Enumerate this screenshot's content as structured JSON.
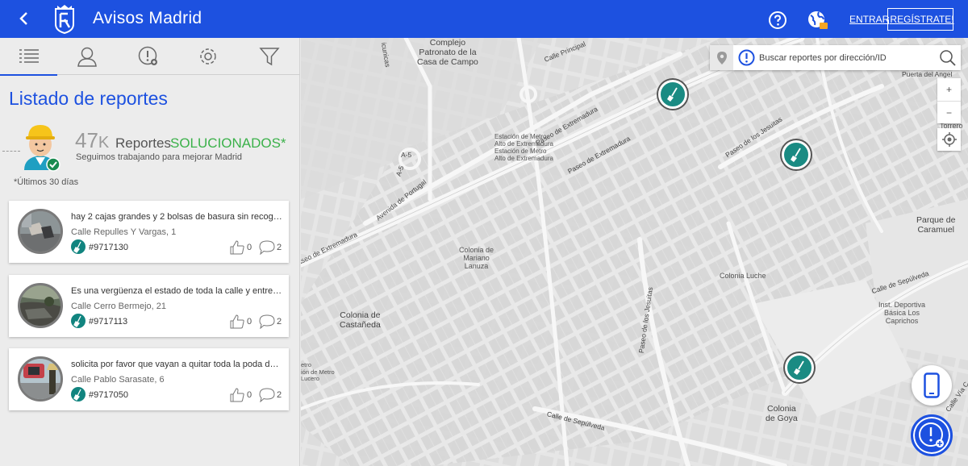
{
  "header": {
    "title": "Avisos Madrid",
    "login_label": "ENTRAR",
    "register_label": "¡REGÍSTRATE!",
    "color": "#1d51e0"
  },
  "sidebar": {
    "tabs": [
      {
        "name": "list-icon",
        "active": true
      },
      {
        "name": "user-icon",
        "active": false
      },
      {
        "name": "report-alert-icon",
        "active": false
      },
      {
        "name": "gear-icon",
        "active": false
      },
      {
        "name": "filter-icon",
        "active": false
      }
    ],
    "list_title": "Listado de reportes",
    "stats": {
      "count": "47",
      "unit": "K",
      "reports_label": "Reportes",
      "solved_label": "SOLUCIONADOS*",
      "subtitle": "Seguimos trabajando para mejorar Madrid",
      "note": "*Últimos 30 días"
    },
    "reports": [
      {
        "title": "hay 2 cajas grandes y 2 bolsas de basura sin recoger ...",
        "address": "Calle Repulles Y Vargas, 1",
        "id": "#9717130",
        "likes": "0",
        "comments": "2"
      },
      {
        "title": "Es una vergüenza el estado de toda la calle y entre los...",
        "address": "Calle Cerro Bermejo, 21",
        "id": "#9717113",
        "likes": "0",
        "comments": "2"
      },
      {
        "title": "solicita por favor que vayan a quitar toda la poda de u...",
        "address": "Calle Pablo Sarasate, 6",
        "id": "#9717050",
        "likes": "0",
        "comments": "2"
      }
    ]
  },
  "map": {
    "search_placeholder": "Buscar reportes por dirección/ID",
    "zoom_in": "+",
    "zoom_out": "−",
    "marker_color": "#1a8b83",
    "labels": {
      "complejo": "Complejo\nPatronato de la\nCasa de Campo",
      "calle_principal": "Calle Principal",
      "paseo_extremadura_1": "Paseo de Extremadura",
      "paseo_extremadura_2": "Paseo de Extremadura",
      "paseo_extremadura_3": "aseo de Extremadura",
      "metro_alto": "Estación de Metro\nAlto de Extremadura\nEstación de Metro\nAlto de Extremadura",
      "a5": "A-5",
      "a5b": "A-5",
      "avenida_portugal": "Avenida de Portugal",
      "paseo_jesuitas_1": "Paseo de los Jesuitas",
      "paseo_jesuitas_2": "Paseo de los Jesuitas",
      "puerta_angel": "Puerta del Angel",
      "parque_caramuel": "Parque de\nCaramuel",
      "colonia_mariano": "Colonia de\nMariano\nLanuza",
      "colonia_luche": "Colonia Luche",
      "calle_sepulveda_1": "Calle de Sepúlveda",
      "calle_sepulveda_2": "Calle de Sepúlveda",
      "inst_deportiva": "Inst. Deportiva\nBásica Los\nCaprichos",
      "colonia_castaneda": "Colonia de\nCastañeda",
      "metro_lucero": "etro\nión de Metro\nLucero",
      "colonia_goya": "Colonia\nde Goya",
      "calle_via": "Calle Vía C",
      "c_torrero": "C\nde\nTorrero",
      "comunicas": "icunicas"
    }
  }
}
